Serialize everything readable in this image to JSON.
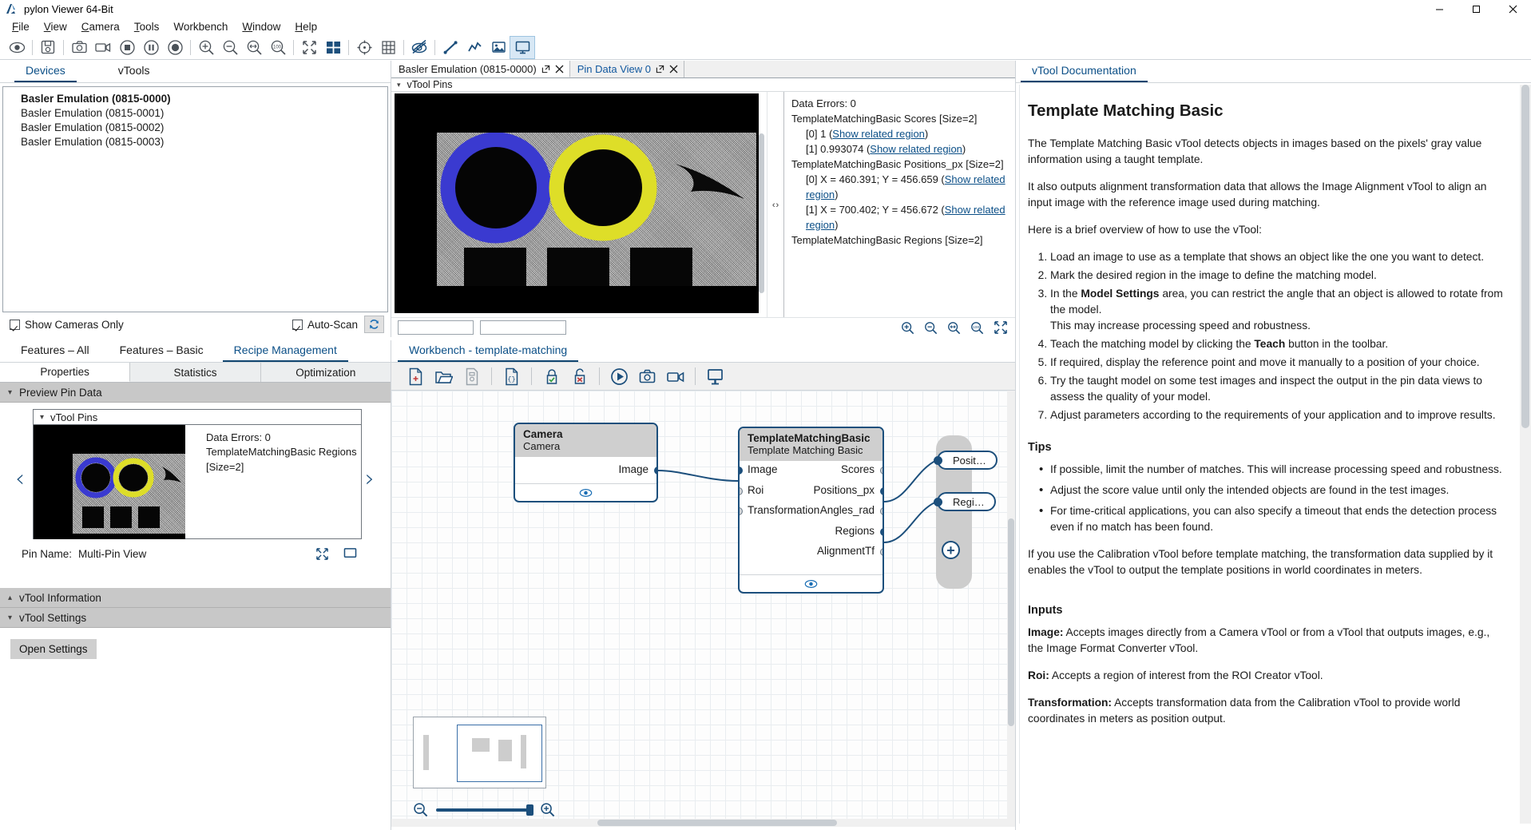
{
  "window": {
    "title": "pylon Viewer 64-Bit",
    "app_icon": "pylon-logo-icon",
    "minimize_label": "─",
    "maximize_label": "❐",
    "close_label": "✕"
  },
  "menubar": {
    "items": [
      {
        "label": "File",
        "accel": "F"
      },
      {
        "label": "View",
        "accel": "V"
      },
      {
        "label": "Camera",
        "accel": "C"
      },
      {
        "label": "Tools",
        "accel": "T"
      },
      {
        "label": "Workbench",
        "accel": ""
      },
      {
        "label": "Window",
        "accel": "W"
      },
      {
        "label": "Help",
        "accel": "H"
      }
    ]
  },
  "toolbar": {
    "buttons": [
      {
        "name": "continuous-shot-icon",
        "tooltip": "Continuous Shot"
      },
      {
        "name": "save-image-icon",
        "tooltip": "Save Image"
      },
      {
        "name": "single-shot-icon",
        "tooltip": "Single Shot"
      },
      {
        "name": "record-video-icon",
        "tooltip": "Record Video"
      },
      {
        "name": "stop-icon",
        "tooltip": "Stop"
      },
      {
        "name": "pause-icon",
        "tooltip": "Pause"
      },
      {
        "name": "record-icon",
        "tooltip": "Record"
      },
      {
        "name": "zoom-in-icon",
        "tooltip": "Zoom In"
      },
      {
        "name": "zoom-out-icon",
        "tooltip": "Zoom Out"
      },
      {
        "name": "zoom-fit-icon",
        "tooltip": "Fit To Window"
      },
      {
        "name": "zoom-100-icon",
        "tooltip": "Zoom 100%"
      },
      {
        "name": "fullscreen-icon",
        "tooltip": "Full Screen"
      },
      {
        "name": "tile-windows-icon",
        "tooltip": "Tile Windows"
      },
      {
        "name": "crosshair-icon",
        "tooltip": "Show Crosshair"
      },
      {
        "name": "grid-icon",
        "tooltip": "Show Grid"
      },
      {
        "name": "hide-overlay-icon",
        "tooltip": "Hide Overlay"
      },
      {
        "name": "line-profile-icon",
        "tooltip": "Line Profile"
      },
      {
        "name": "histogram-icon",
        "tooltip": "Histogram"
      },
      {
        "name": "image-window-icon",
        "tooltip": "Image Window"
      },
      {
        "name": "workbench-icon",
        "tooltip": "Workbench"
      }
    ]
  },
  "devices_panel": {
    "tabs": [
      {
        "label": "Devices",
        "selected": true
      },
      {
        "label": "vTools",
        "selected": false
      }
    ],
    "devices": [
      {
        "label": "Basler Emulation (0815-0000)",
        "selected": true
      },
      {
        "label": "Basler Emulation (0815-0001)",
        "selected": false
      },
      {
        "label": "Basler Emulation (0815-0002)",
        "selected": false
      },
      {
        "label": "Basler Emulation (0815-0003)",
        "selected": false
      }
    ],
    "show_cameras_only": {
      "label": "Show Cameras Only",
      "checked": true
    },
    "auto_scan": {
      "label": "Auto-Scan",
      "checked": true
    },
    "refresh_icon": "refresh-icon"
  },
  "features_panel": {
    "tabs": [
      {
        "label": "Features – All",
        "selected": false
      },
      {
        "label": "Features – Basic",
        "selected": false
      },
      {
        "label": "Recipe Management",
        "selected": true
      }
    ],
    "subtabs": [
      {
        "label": "Properties",
        "selected": true
      },
      {
        "label": "Statistics",
        "selected": false
      },
      {
        "label": "Optimization",
        "selected": false
      }
    ],
    "groups": [
      {
        "label": "Preview Pin Data",
        "expanded": true
      },
      {
        "label": "vTool Information",
        "expanded": false
      },
      {
        "label": "vTool Settings",
        "expanded": true
      }
    ],
    "preview": {
      "card_title": "vTool Pins",
      "data_errors": "Data Errors: 0",
      "regions_line": "TemplateMatchingBasic Regions [Size=2]",
      "prev_arrow": "‹",
      "next_arrow": "›",
      "pin_name_label": "Pin Name:",
      "pin_name_value": "Multi-Pin View",
      "fullscreen_icon": "fullscreen-icon",
      "detach_icon": "detach-window-icon"
    },
    "open_settings_label": "Open Settings"
  },
  "image_panel": {
    "doc_tabs": [
      {
        "label": "Basler Emulation (0815-0000)",
        "selected": true,
        "accent": false,
        "detach_icon": "detach-icon",
        "close_icon": "close-icon"
      },
      {
        "label": "Pin Data View 0",
        "selected": false,
        "accent": true,
        "detach_icon": "detach-icon",
        "close_icon": "close-icon"
      }
    ],
    "vtool_pins_label": "vTool Pins",
    "splitter_left": "‹",
    "splitter_right": "›",
    "pin_data": {
      "data_errors": "Data Errors: 0",
      "scores_header": "TemplateMatchingBasic Scores [Size=2]",
      "scores": [
        {
          "index": "[0]",
          "value": "1",
          "link": "Show related region"
        },
        {
          "index": "[1]",
          "value": "0.993074",
          "link": "Show related region"
        }
      ],
      "positions_header": "TemplateMatchingBasic Positions_px [Size=2]",
      "positions": [
        {
          "index": "[0]",
          "value": "X = 460.391; Y = 456.659",
          "link": "Show related region"
        },
        {
          "index": "[1]",
          "value": "X = 700.402; Y = 456.672",
          "link": "Show related region"
        }
      ],
      "regions_header": "TemplateMatchingBasic Regions [Size=2]"
    },
    "status_field_1": "",
    "status_field_2": "",
    "zoom_icons": [
      "zoom-in-icon",
      "zoom-out-icon",
      "zoom-fit-icon",
      "zoom-100-icon",
      "fullscreen-icon"
    ]
  },
  "workbench": {
    "tabs": [
      {
        "label": "Workbench - template-matching",
        "selected": true
      }
    ],
    "toolbar": [
      {
        "name": "new-recipe-icon",
        "tooltip": "New Recipe"
      },
      {
        "name": "open-recipe-icon",
        "tooltip": "Open Recipe"
      },
      {
        "name": "save-recipe-icon",
        "tooltip": "Save Recipe",
        "disabled": true
      },
      {
        "name": "json-recipe-icon",
        "tooltip": "Edit Recipe Source"
      },
      {
        "name": "lock-recipe-icon",
        "tooltip": "Lock Recipe"
      },
      {
        "name": "unlock-recipe-icon",
        "tooltip": "Unlock Recipe"
      },
      {
        "name": "run-recipe-icon",
        "tooltip": "Start Recipe"
      },
      {
        "name": "single-shot-icon",
        "tooltip": "Single Shot"
      },
      {
        "name": "continuous-shot-icon",
        "tooltip": "Continuous Shot"
      },
      {
        "name": "open-pin-view-icon",
        "tooltip": "Open Pin Data View"
      }
    ],
    "nodes": [
      {
        "title": "Camera",
        "subtitle": "Camera",
        "inputs": [],
        "outputs": [
          {
            "label": "Image",
            "connected": true
          }
        ],
        "eye_icon": "eye-icon"
      },
      {
        "title": "TemplateMatchingBasic",
        "subtitle": "Template Matching Basic",
        "inputs": [
          {
            "label": "Image",
            "connected": true
          },
          {
            "label": "Roi",
            "connected": false
          },
          {
            "label": "Transformation",
            "connected": false
          }
        ],
        "outputs": [
          {
            "label": "Scores",
            "connected": false
          },
          {
            "label": "Positions_px",
            "connected": true
          },
          {
            "label": "Angles_rad",
            "connected": false
          },
          {
            "label": "Regions",
            "connected": true
          },
          {
            "label": "AlignmentTf",
            "connected": false
          }
        ],
        "eye_icon": "eye-icon"
      }
    ],
    "output_pills": [
      {
        "label": "Posit…"
      },
      {
        "label": "Regi…"
      }
    ],
    "add_output_icon": "plus-circle-icon",
    "zoom_out_icon": "zoom-out-icon",
    "zoom_in_icon": "zoom-in-icon"
  },
  "documentation": {
    "tabs": [
      {
        "label": "vTool Documentation",
        "selected": true
      }
    ],
    "heading": "Template Matching Basic",
    "paragraphs": [
      "The Template Matching Basic vTool detects objects in images based on the pixels' gray value information using a taught template.",
      "It also outputs alignment transformation data that allows the Image Alignment vTool to align an input image with the reference image used during matching.",
      "Here is a brief overview of how to use the vTool:"
    ],
    "steps": [
      "Load an image to use as a template that shows an object like the one you want to detect.",
      "Mark the desired region in the image to define the matching model.",
      "In the <b>Model Settings</b> area, you can restrict the angle that an object is allowed to rotate from the model.<br>This may increase processing speed and robustness.",
      "Teach the matching model by clicking the <b>Teach</b> button in the toolbar.",
      "If required, display the reference point and move it manually to a position of your choice.",
      "Try the taught model on some test images and inspect the output in the pin data views to assess the quality of your model.",
      "Adjust parameters according to the requirements of your application and to improve results."
    ],
    "tips_heading": "Tips",
    "tips": [
      "If possible, limit the number of matches. This will increase processing speed and robustness.",
      "Adjust the score value until only the intended objects are found in the test images.",
      "For time-critical applications, you can also specify a timeout that ends the detection process even if no match has been found."
    ],
    "calibration_paragraph": "If you use the Calibration vTool before template matching, the transformation data supplied by it enables the vTool to output the template positions in world coordinates in meters.",
    "inputs_heading": "Inputs",
    "inputs": [
      {
        "name": "Image:",
        "text": " Accepts images directly from a Camera vTool or from a vTool that outputs images, e.g., the Image Format Converter vTool."
      },
      {
        "name": "Roi:",
        "text": " Accepts a region of interest from the ROI Creator vTool."
      },
      {
        "name": "Transformation:",
        "text": " Accepts transformation data from the Calibration vTool to provide world coordinates in meters as position output."
      }
    ]
  },
  "colors": {
    "accent": "#10579e",
    "node_border": "#1c4f7c",
    "node_header": "#cfcfcf",
    "tab_underline": "#10456f",
    "group_header": "#c8c8c8",
    "match_blue": "#3a3ad0",
    "match_yellow": "#dede28"
  }
}
